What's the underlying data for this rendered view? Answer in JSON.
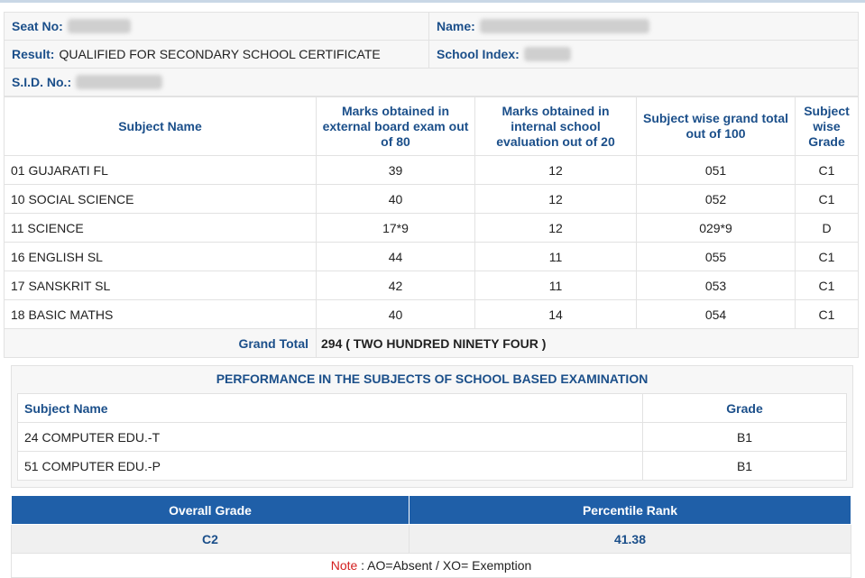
{
  "student": {
    "seat_no_label": "Seat No:",
    "name_label": "Name:",
    "result_label": "Result:",
    "result_value": "QUALIFIED FOR SECONDARY SCHOOL CERTIFICATE",
    "school_index_label": "School Index:",
    "sid_label": "S.I.D. No.:"
  },
  "marks_table": {
    "headers": [
      "Subject Name",
      "Marks obtained in external board exam out of 80",
      "Marks obtained in internal school evaluation out of 20",
      "Subject wise grand total out of 100",
      "Subject wise Grade"
    ],
    "rows": [
      {
        "subject": "01 GUJARATI FL",
        "external": "39",
        "internal": "12",
        "total": "051",
        "grade": "C1"
      },
      {
        "subject": "10 SOCIAL SCIENCE",
        "external": "40",
        "internal": "12",
        "total": "052",
        "grade": "C1"
      },
      {
        "subject": "11 SCIENCE",
        "external": "17*9",
        "internal": "12",
        "total": "029*9",
        "grade": "D"
      },
      {
        "subject": "16 ENGLISH SL",
        "external": "44",
        "internal": "11",
        "total": "055",
        "grade": "C1"
      },
      {
        "subject": "17 SANSKRIT SL",
        "external": "42",
        "internal": "11",
        "total": "053",
        "grade": "C1"
      },
      {
        "subject": "18 BASIC MATHS",
        "external": "40",
        "internal": "14",
        "total": "054",
        "grade": "C1"
      }
    ],
    "grand_total_label": "Grand Total",
    "grand_total_value": "294 ( TWO HUNDRED NINETY FOUR )"
  },
  "school_based": {
    "title": "PERFORMANCE IN THE SUBJECTS OF SCHOOL BASED EXAMINATION",
    "headers": [
      "Subject Name",
      "Grade"
    ],
    "rows": [
      {
        "subject": "24 COMPUTER EDU.-T",
        "grade": "B1"
      },
      {
        "subject": "51 COMPUTER EDU.-P",
        "grade": "B1"
      }
    ]
  },
  "overall": {
    "grade_label": "Overall Grade",
    "grade_value": "C2",
    "percentile_label": "Percentile Rank",
    "percentile_value": "41.38"
  },
  "note": {
    "label": "Note",
    "text": ": AO=Absent / XO= Exemption"
  }
}
